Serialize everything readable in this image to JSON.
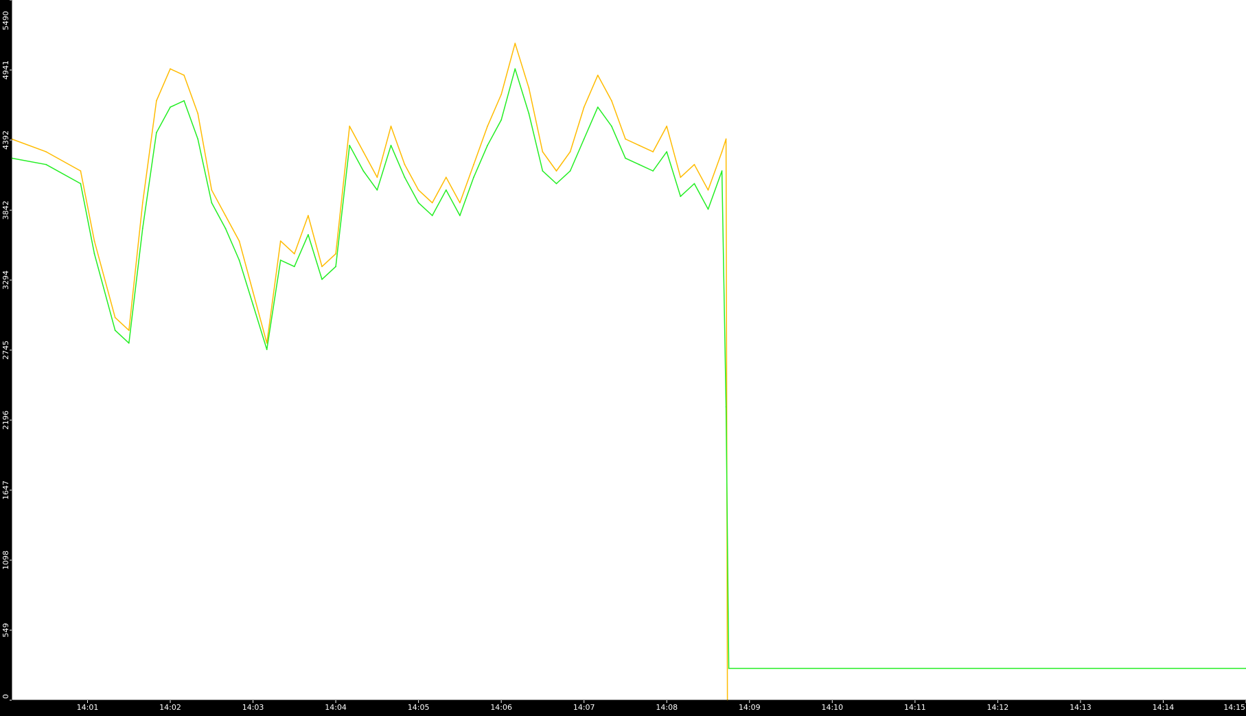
{
  "chart_data": {
    "type": "line",
    "title": "",
    "xlabel": "",
    "ylabel": "",
    "grid": false,
    "legend": "none",
    "colors": {
      "background": "#000000",
      "plot_background": "#ffffff",
      "axis": "#000000",
      "tick_text": "#ffffff",
      "series_orange": "#ffbb00",
      "series_green": "#22ee22"
    },
    "y_ticks": [
      "0",
      "549",
      "1098",
      "1647",
      "2196",
      "2745",
      "3294",
      "3842",
      "4392",
      "4941",
      "5490"
    ],
    "x_ticks": [
      "14:01",
      "14:02",
      "14:03",
      "14:04",
      "14:05",
      "14:06",
      "14:07",
      "14:08",
      "14:09",
      "14:10",
      "14:11",
      "14:12",
      "14:13",
      "14:14",
      "14:15"
    ],
    "ylim": [
      0,
      5490
    ],
    "xlim": [
      "14:00:05",
      "14:15:00"
    ],
    "series": [
      {
        "color": "#ffbb00",
        "x": [
          "14:00:05",
          "14:00:30",
          "14:00:55",
          "14:01:05",
          "14:01:20",
          "14:01:30",
          "14:01:40",
          "14:01:50",
          "14:02:00",
          "14:02:10",
          "14:02:20",
          "14:02:30",
          "14:02:40",
          "14:02:50",
          "14:03:00",
          "14:03:10",
          "14:03:20",
          "14:03:30",
          "14:03:40",
          "14:03:50",
          "14:04:00",
          "14:04:10",
          "14:04:20",
          "14:04:30",
          "14:04:40",
          "14:04:50",
          "14:05:00",
          "14:05:10",
          "14:05:20",
          "14:05:30",
          "14:05:40",
          "14:05:50",
          "14:06:00",
          "14:06:10",
          "14:06:20",
          "14:06:30",
          "14:06:40",
          "14:06:50",
          "14:07:00",
          "14:07:10",
          "14:07:20",
          "14:07:30",
          "14:07:40",
          "14:07:50",
          "14:08:00",
          "14:08:10",
          "14:08:20",
          "14:08:30",
          "14:08:40",
          "14:08:43",
          "14:08:44"
        ],
        "y": [
          4400,
          4300,
          4150,
          3600,
          3000,
          2900,
          3900,
          4700,
          4950,
          4900,
          4600,
          4000,
          3800,
          3600,
          3200,
          2800,
          3600,
          3500,
          3800,
          3400,
          3500,
          4500,
          4300,
          4100,
          4500,
          4200,
          4000,
          3900,
          4100,
          3900,
          4200,
          4500,
          4750,
          5150,
          4800,
          4300,
          4150,
          4300,
          4650,
          4900,
          4700,
          4400,
          4350,
          4300,
          4500,
          4100,
          4200,
          4000,
          4300,
          4400,
          0
        ]
      },
      {
        "color": "#22ee22",
        "x": [
          "14:00:05",
          "14:00:30",
          "14:00:55",
          "14:01:05",
          "14:01:20",
          "14:01:30",
          "14:01:40",
          "14:01:50",
          "14:02:00",
          "14:02:10",
          "14:02:20",
          "14:02:30",
          "14:02:40",
          "14:02:50",
          "14:03:00",
          "14:03:10",
          "14:03:20",
          "14:03:30",
          "14:03:40",
          "14:03:50",
          "14:04:00",
          "14:04:10",
          "14:04:20",
          "14:04:30",
          "14:04:40",
          "14:04:50",
          "14:05:00",
          "14:05:10",
          "14:05:20",
          "14:05:30",
          "14:05:40",
          "14:05:50",
          "14:06:00",
          "14:06:10",
          "14:06:20",
          "14:06:30",
          "14:06:40",
          "14:06:50",
          "14:07:00",
          "14:07:10",
          "14:07:20",
          "14:07:30",
          "14:07:40",
          "14:07:50",
          "14:08:00",
          "14:08:10",
          "14:08:20",
          "14:08:30",
          "14:08:40",
          "14:08:43",
          "14:08:45",
          "14:15:00"
        ],
        "y": [
          4250,
          4200,
          4050,
          3500,
          2900,
          2800,
          3700,
          4450,
          4650,
          4700,
          4400,
          3900,
          3700,
          3450,
          3100,
          2750,
          3450,
          3400,
          3650,
          3300,
          3400,
          4350,
          4150,
          4000,
          4350,
          4100,
          3900,
          3800,
          4000,
          3800,
          4100,
          4350,
          4550,
          4950,
          4600,
          4150,
          4050,
          4150,
          4400,
          4650,
          4500,
          4250,
          4200,
          4150,
          4300,
          3950,
          4050,
          3850,
          4150,
          2300,
          250,
          250
        ]
      }
    ]
  }
}
